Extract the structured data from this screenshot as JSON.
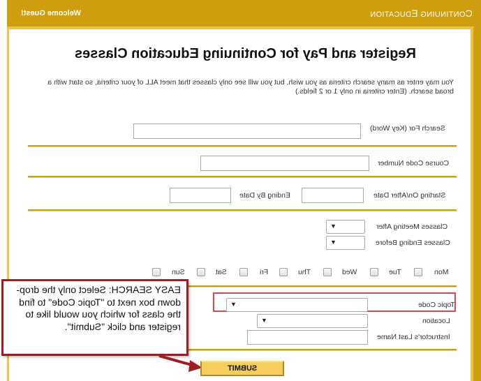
{
  "header": {
    "brand_first": "C",
    "brand_rest_1": "ONTINUING ",
    "brand_e": "E",
    "brand_rest_2": "DUCATION",
    "welcome": "Welcome Guest!"
  },
  "page": {
    "title": "Register and Pay for Continuing Education Classes",
    "intro": "You may enter as many search criteria as you wish, but you will see only classes that meet ALL of your criteria, so start with a broad search. (Enter criteria in only 1 or 2 fields.)"
  },
  "form": {
    "keyword": {
      "label": "Search For (Key Word)",
      "value": ""
    },
    "course_code": {
      "label": "Course Code Number",
      "value": ""
    },
    "start_date": {
      "label": "Starting On/After Date",
      "value": ""
    },
    "end_date": {
      "label": "Ending By Date",
      "value": ""
    },
    "meeting_after": {
      "label": "Classes Meeting After",
      "value": ""
    },
    "ending_before": {
      "label": "Classes Ending Before",
      "value": ""
    },
    "days": [
      {
        "label": "Mon",
        "checked": false
      },
      {
        "label": "Tue",
        "checked": false
      },
      {
        "label": "Wed",
        "checked": false
      },
      {
        "label": "Thu",
        "checked": false
      },
      {
        "label": "Fri",
        "checked": false
      },
      {
        "label": "Sat",
        "checked": false
      },
      {
        "label": "Sun",
        "checked": false
      }
    ],
    "topic_code": {
      "label": "Topic Code",
      "value": ""
    },
    "location": {
      "label": "Location",
      "value": ""
    },
    "instructor": {
      "label": "Instructor's Last Name",
      "value": ""
    },
    "submit_label": "SUBMIT"
  },
  "annotation": {
    "callout_text": "EASY SEARCH: Select only the drop-down box next to \"Topic Code\" to find the class for which you would like to register and click \"Submit\".",
    "highlight_color": "#e04848",
    "callout_border_color": "#a01c22"
  },
  "colors": {
    "brand_gold": "#cf9e0e",
    "light_gold": "#ecc24a",
    "submit_fill": "#f4cd5a"
  },
  "icons": {
    "dropdown": "▼"
  }
}
